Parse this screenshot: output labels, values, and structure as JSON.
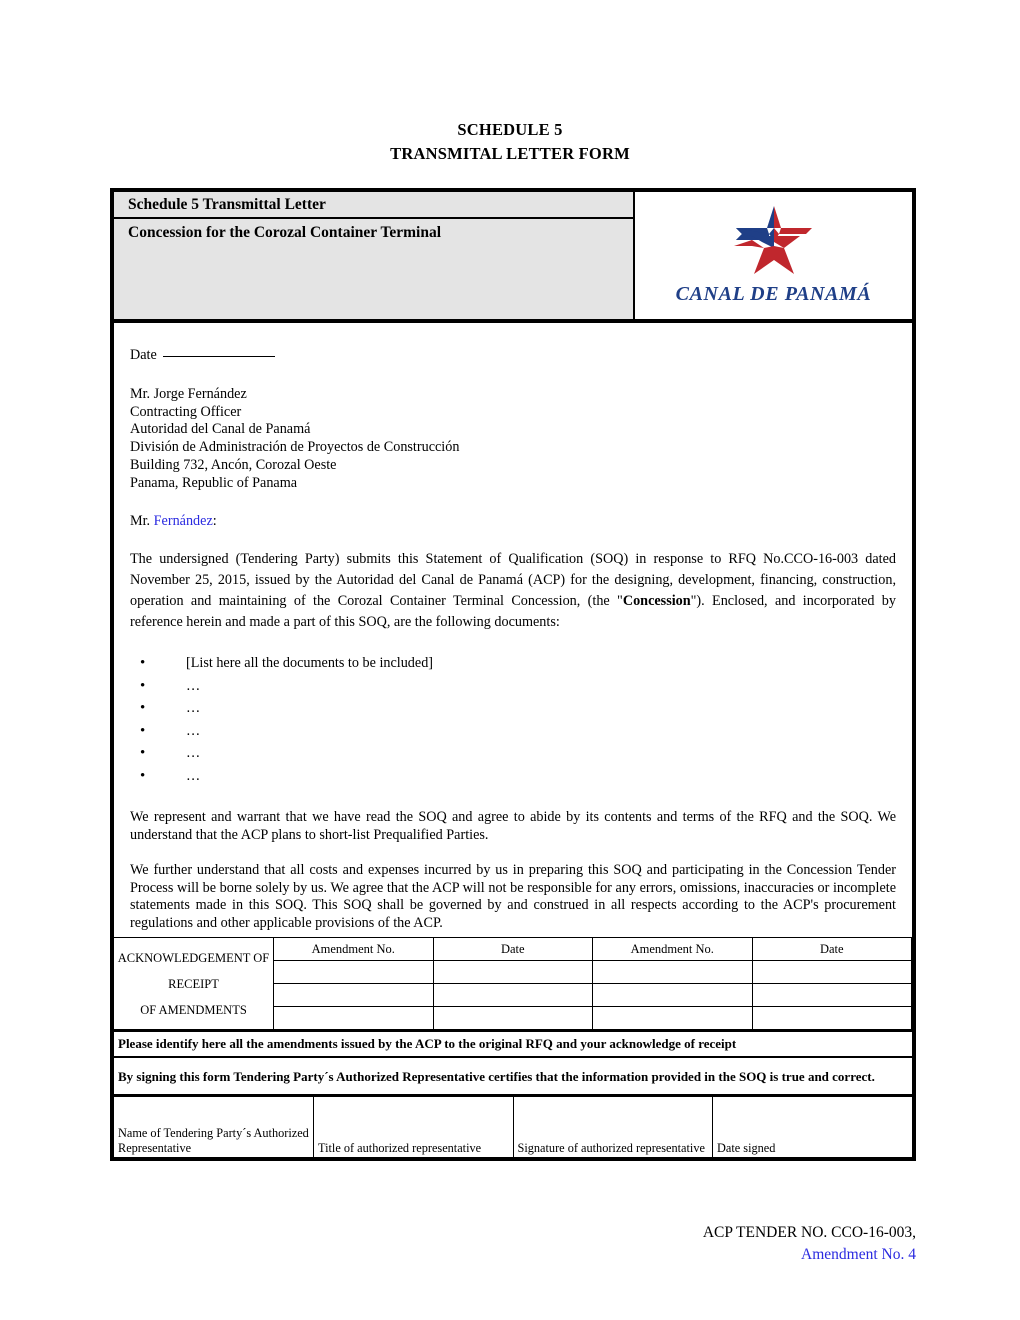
{
  "document": {
    "title_lines": [
      "SCHEDULE 5",
      "TRANSMITAL LETTER FORM"
    ],
    "header": {
      "line1": "Schedule 5 Transmittal Letter",
      "line2": "Concession for the Corozal Container Terminal",
      "logo_wordmark": "CANAL DE PANAMÁ",
      "logo_colors": {
        "blue": "#1f3f87",
        "red": "#c0272d"
      }
    },
    "body": {
      "date_label": "Date",
      "recipient": [
        "Mr. Jorge Fernández",
        "Contracting Officer",
        "Autoridad del Canal de Panamá",
        "División de Administración de Proyectos de Construcción",
        "Building 732, Ancón, Corozal Oeste",
        "Panama, Republic of Panama"
      ],
      "salutation_prefix": "Mr. ",
      "salutation_name": "Fernández",
      "salutation_suffix": ":",
      "salutation_name_color": "#2a2ae0",
      "paragraph_1_part1": "The undersigned (Tendering Party) submits this Statement of Qualification (SOQ) in response to RFQ No.CCO-16-003 dated November 25, 2015, issued by the Autoridad del Canal de Panamá (ACP) for the designing, development, financing, construction, operation and maintaining of the Corozal Container Terminal Concession, (the \"",
      "paragraph_1_bold": "Concession",
      "paragraph_1_part2": "\"). Enclosed, and incorporated by reference herein and made a part of this SOQ, are the following documents:",
      "bullets": [
        "[List here all the documents to be included]",
        "…",
        "…",
        "…",
        "…",
        "…"
      ],
      "paragraph_2": "We represent and warrant that we have read the SOQ and agree to abide by its contents and terms of the RFQ and the SOQ. We understand that the ACP plans to short-list Prequalified Parties.",
      "paragraph_3": "We further understand that all costs and expenses incurred by us in preparing this SOQ and participating in the Concession Tender Process will be borne solely by us.    We agree that the ACP will not be responsible for any errors, omissions, inaccuracies or incomplete statements made in this SOQ. This SOQ shall be governed by and construed in all respects according to the ACP's procurement regulations and other applicable provisions of the ACP."
    },
    "amendment_table": {
      "row_label_line1": "ACKNOWLEDGEMENT OF RECEIPT",
      "row_label_line2": "OF AMENDMENTS",
      "headers": [
        "Amendment No.",
        "Date",
        "Amendment No.",
        "Date"
      ],
      "rows": [
        [
          "",
          "",
          "",
          ""
        ],
        [
          "",
          "",
          "",
          ""
        ],
        [
          "",
          "",
          "",
          ""
        ]
      ],
      "notice": "Please identify here all the amendments issued by the ACP to the original RFQ and your acknowledge of receipt"
    },
    "certification": {
      "statement": "By signing this form Tendering Party´s Authorized Representative certifies that the information provided in the SOQ is true and correct.",
      "signature_fields": [
        "Name of Tendering Party´s Authorized Representative",
        "Title of authorized representative",
        "Signature of authorized representative",
        "Date signed"
      ]
    },
    "footer": {
      "line1": "ACP TENDER NO. CCO-16-003,",
      "line2": "Amendment No. 4",
      "line2_color": "#2a2ae0"
    }
  }
}
